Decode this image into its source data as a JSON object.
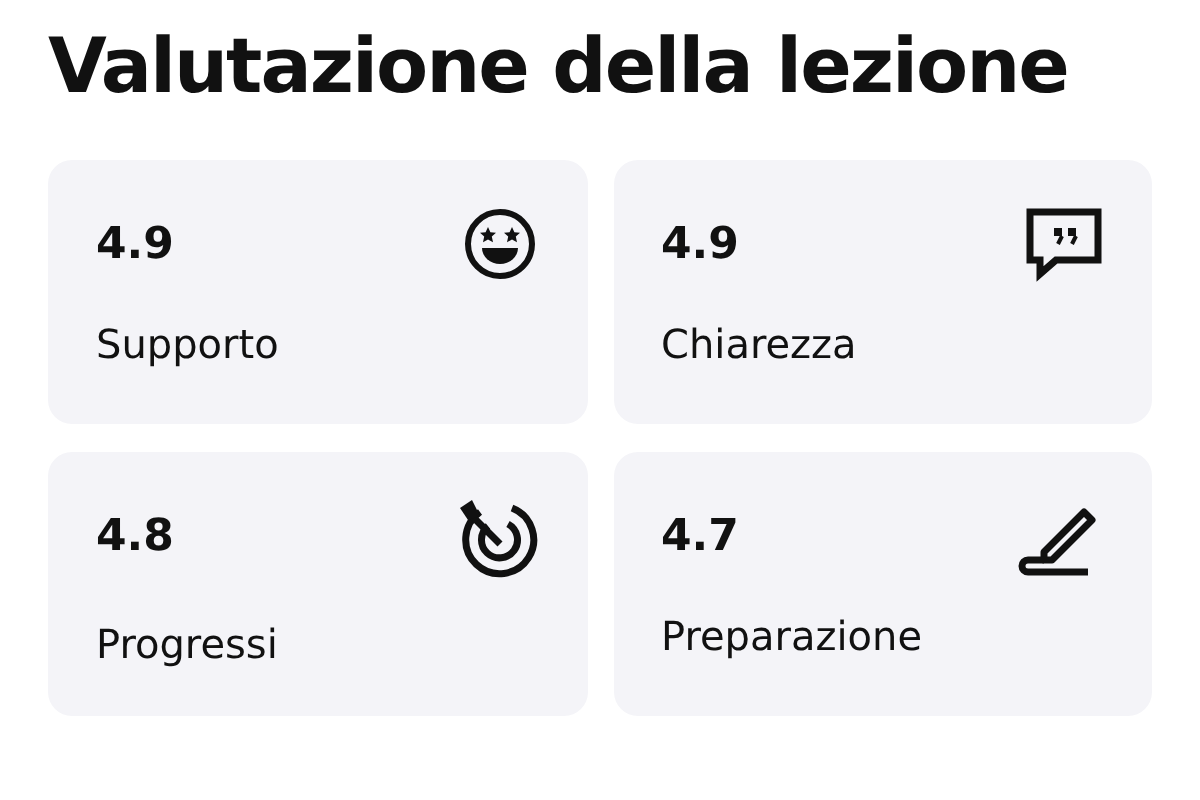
{
  "title": "Valutazione della lezione",
  "ratings": [
    {
      "value": "4.9",
      "label": "Supporto",
      "kind": "smile"
    },
    {
      "value": "4.9",
      "label": "Chiarezza",
      "kind": "quote"
    },
    {
      "value": "4.8",
      "label": "Progressi",
      "kind": "target"
    },
    {
      "value": "4.7",
      "label": "Preparazione",
      "kind": "pencil"
    }
  ]
}
